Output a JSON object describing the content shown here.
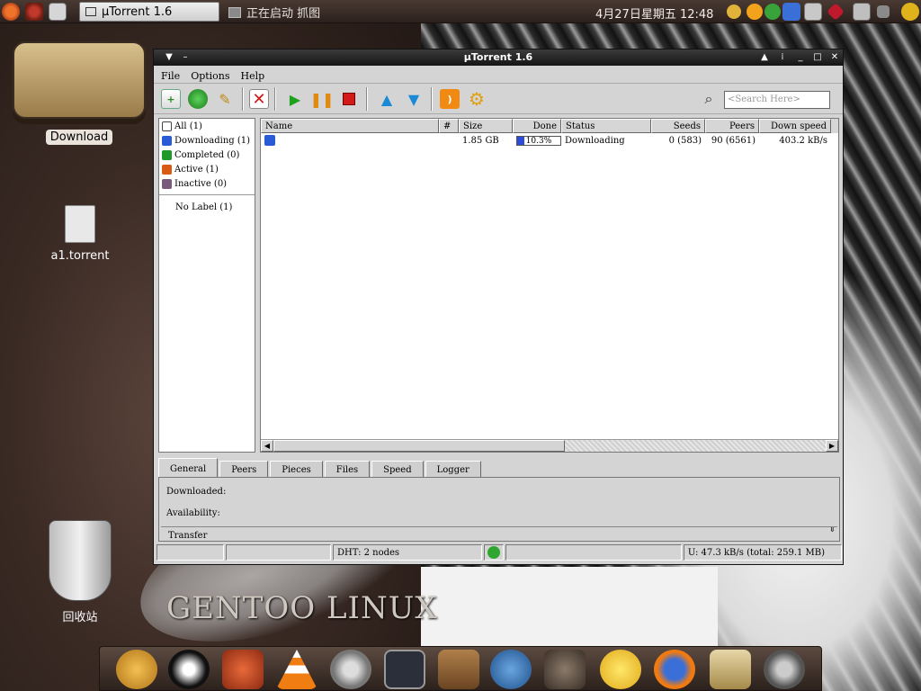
{
  "panel": {
    "task_utorrent": "µTorrent 1.6",
    "task_starting": "正在启动 抓图",
    "clock": "4月27日星期五 12:48"
  },
  "desktop": {
    "icon_download": "Download",
    "icon_torrent": "a1.torrent",
    "icon_trash": "回收站",
    "wallpaper_text": "GENTOO LINUX"
  },
  "window": {
    "title": "µTorrent 1.6",
    "menu": [
      "File",
      "Options",
      "Help"
    ],
    "search_placeholder": "<Search Here>",
    "sidebar": {
      "items": [
        {
          "label": "All (1)",
          "icon": "all-icon",
          "color": "#444444"
        },
        {
          "label": "Downloading (1)",
          "icon": "download-arrow-icon",
          "color": "#2a5bd7"
        },
        {
          "label": "Completed (0)",
          "icon": "check-up-icon",
          "color": "#1f9a2a"
        },
        {
          "label": "Active (1)",
          "icon": "active-arrows-icon",
          "color": "#d95a12"
        },
        {
          "label": "Inactive (0)",
          "icon": "inactive-icon",
          "color": "#7a5a7a"
        }
      ],
      "no_label": "No Label (1)"
    },
    "columns": [
      "Name",
      "#",
      "Size",
      "Done",
      "Status",
      "Seeds",
      "Peers",
      "Down speed"
    ],
    "rows": [
      {
        "name": "",
        "num": "",
        "size": "1.85 GB",
        "done": "10.3%",
        "done_fraction": 0.103,
        "status": "Downloading",
        "seeds": "0 (583)",
        "peers": "90 (6561)",
        "down_speed": "403.2 kB/s"
      }
    ],
    "tabs": [
      "General",
      "Peers",
      "Pieces",
      "Files",
      "Speed",
      "Logger"
    ],
    "details": {
      "downloaded": "Downloaded:",
      "availability": "Availability:",
      "transfer": "Transfer"
    },
    "statusbar": {
      "dht": "DHT: 2 nodes",
      "upload": "U: 47.3 kB/s  (total: 259.1 MB)"
    }
  }
}
